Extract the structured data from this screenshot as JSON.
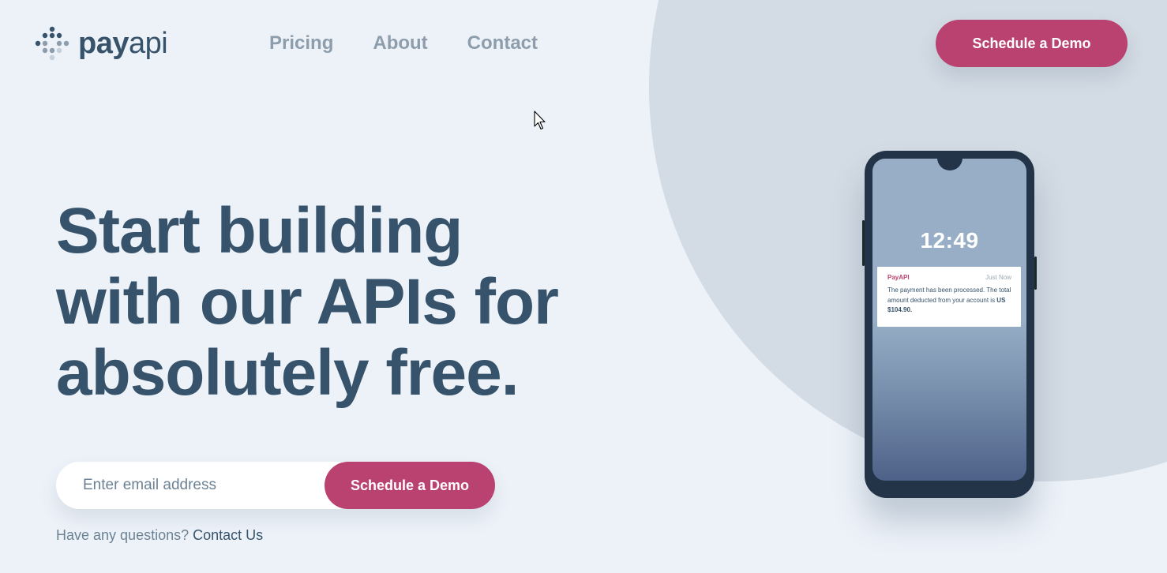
{
  "logo": {
    "part_bold": "pay",
    "part_light": "api",
    "icon": "dots-logo-icon"
  },
  "nav": {
    "items": [
      "Pricing",
      "About",
      "Contact"
    ]
  },
  "header": {
    "cta_label": "Schedule a Demo"
  },
  "hero": {
    "title_lines": [
      "Start building",
      "with our APIs for",
      "absolutely free."
    ]
  },
  "form": {
    "email_placeholder": "Enter email address",
    "cta_label": "Schedule a Demo"
  },
  "footer_note": {
    "question": "Have any questions? ",
    "link": "Contact Us"
  },
  "phone": {
    "time": "12:49",
    "notification": {
      "app": "PayAPI",
      "time": "Just Now",
      "message": "The payment has been processed. The total amount deducted from your account is ",
      "amount": "US $104.90."
    }
  },
  "colors": {
    "background": "#EDF2F9",
    "circle": "#D3DBE4",
    "primary_text": "#36536B",
    "nav_text": "#8D9DAB",
    "accent": "#BA4270"
  }
}
